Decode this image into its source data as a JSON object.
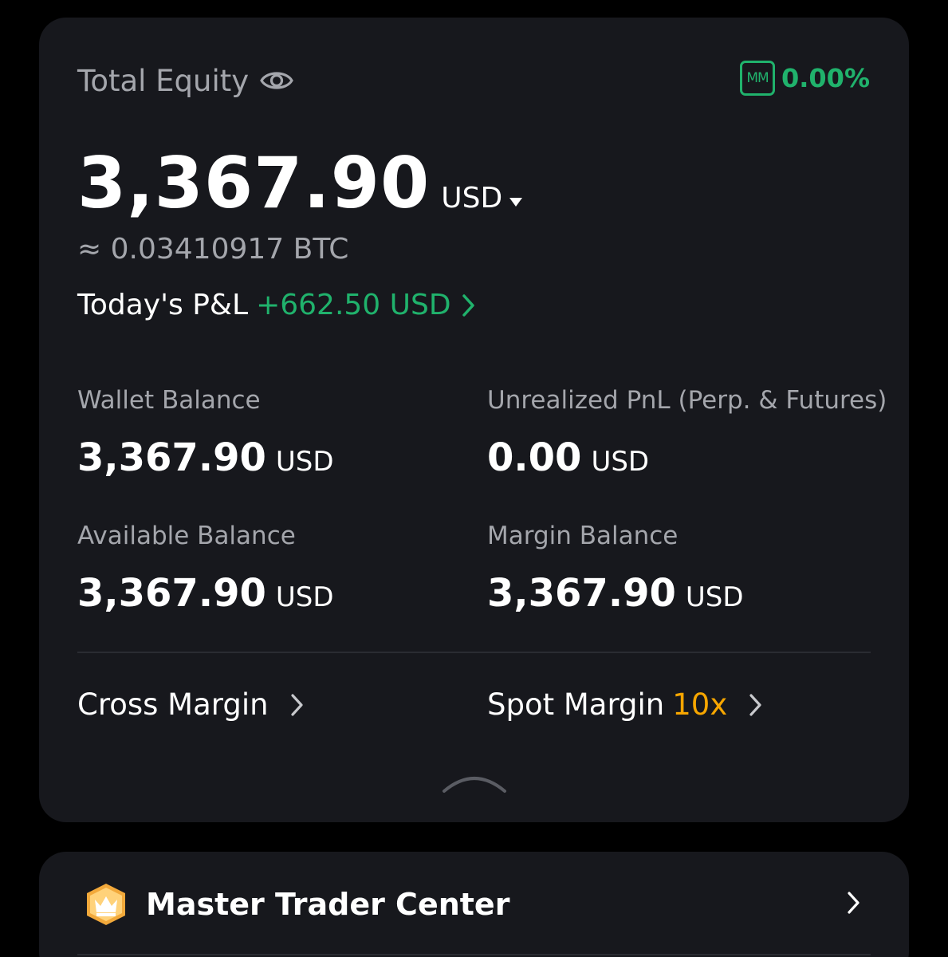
{
  "equity": {
    "label": "Total Equity",
    "mm_badge": "MM",
    "mm_ratio": "0.00%",
    "amount": "3,367.90",
    "currency": "USD",
    "btc_equivalent": "≈ 0.03410917 BTC",
    "pnl_label": "Today's P&L",
    "pnl_value": "+662.50 USD"
  },
  "stats": {
    "wallet_balance": {
      "label": "Wallet Balance",
      "value": "3,367.90",
      "currency": "USD"
    },
    "unrealized_pnl": {
      "label": "Unrealized PnL (Perp. & Futures)",
      "value": "0.00",
      "currency": "USD"
    },
    "available_balance": {
      "label": "Available Balance",
      "value": "3,367.90",
      "currency": "USD"
    },
    "margin_balance": {
      "label": "Margin Balance",
      "value": "3,367.90",
      "currency": "USD"
    }
  },
  "links": {
    "cross_margin": "Cross Margin",
    "spot_margin": "Spot Margin",
    "spot_margin_leverage": "10x"
  },
  "trader": {
    "label": "Master Trader Center"
  },
  "colors": {
    "background": "#000000",
    "card": "#17181d",
    "positive": "#20b26c",
    "accent": "#f7a600",
    "muted_text": "#a4a6ac",
    "text": "#ffffff"
  },
  "icons": [
    "eye-icon",
    "caret-down-icon",
    "chevron-right-icon",
    "chevron-up-icon",
    "crown-icon"
  ]
}
